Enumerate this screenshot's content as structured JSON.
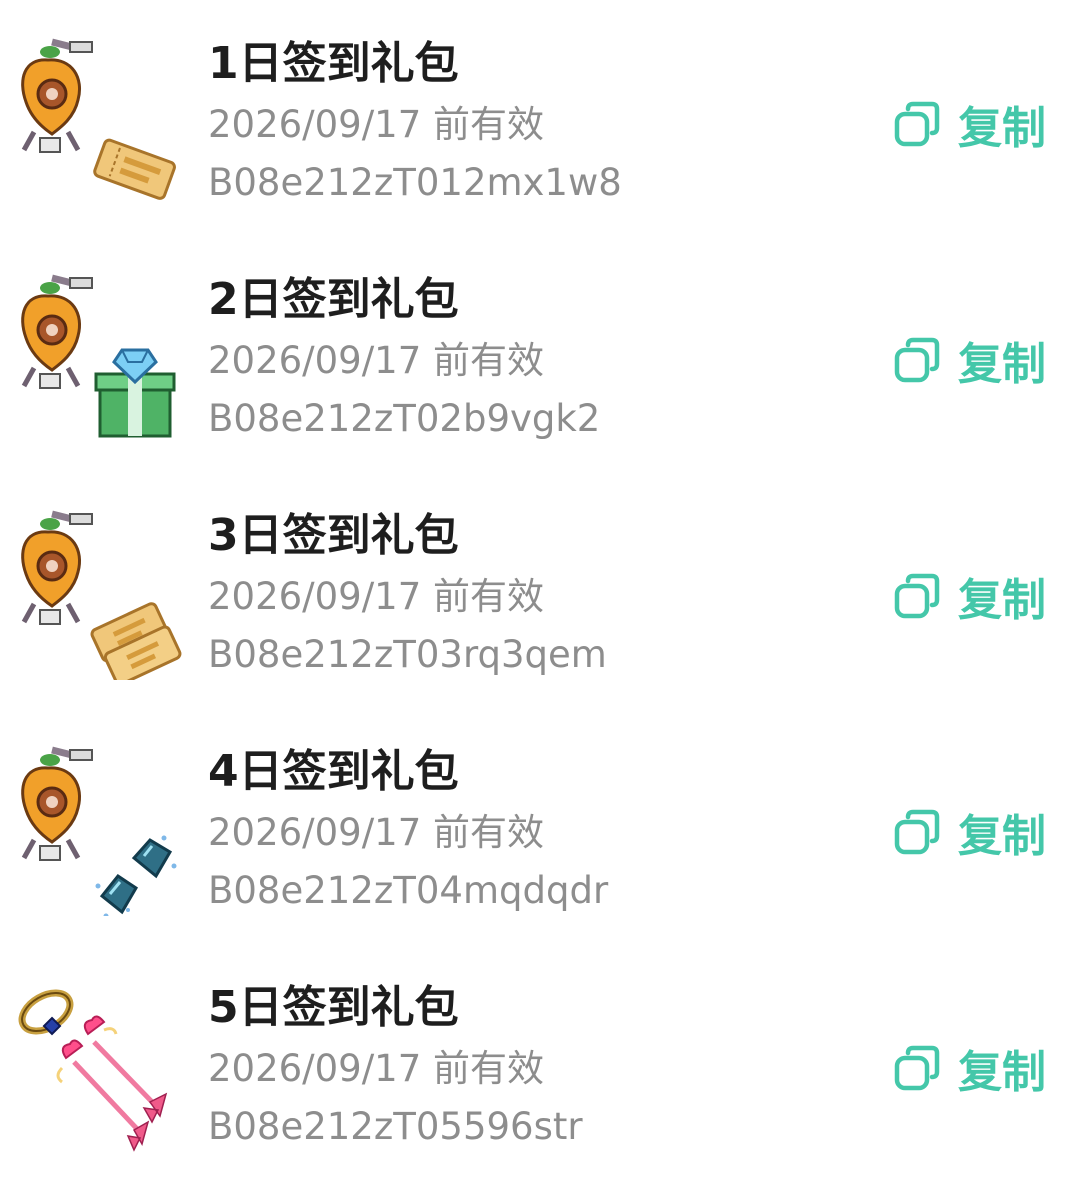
{
  "theme": {
    "accent": "#44c7a9",
    "title_color": "#1e1e1e",
    "meta_color": "#8d8d8d"
  },
  "items": [
    {
      "title": "1日签到礼包",
      "expiry": "2026/09/17 前有效",
      "code": "B08e212zT012mx1w8",
      "copy_label": "复制",
      "icons": [
        "apple-robot-icon",
        "ticket-icon"
      ]
    },
    {
      "title": "2日签到礼包",
      "expiry": "2026/09/17 前有效",
      "code": "B08e212zT02b9vgk2",
      "copy_label": "复制",
      "icons": [
        "apple-robot-icon",
        "diamond-giftbox-icon"
      ]
    },
    {
      "title": "3日签到礼包",
      "expiry": "2026/09/17 前有效",
      "code": "B08e212zT03rq3qem",
      "copy_label": "复制",
      "icons": [
        "apple-robot-icon",
        "double-ticket-icon"
      ]
    },
    {
      "title": "4日签到礼包",
      "expiry": "2026/09/17 前有效",
      "code": "B08e212zT04mqdqdr",
      "copy_label": "复制",
      "icons": [
        "apple-robot-icon",
        "crystal-gems-icon"
      ]
    },
    {
      "title": "5日签到礼包",
      "expiry": "2026/09/17 前有效",
      "code": "B08e212zT05596str",
      "copy_label": "复制",
      "icons": [
        "ring-icon",
        "heart-arrows-icon"
      ]
    }
  ]
}
